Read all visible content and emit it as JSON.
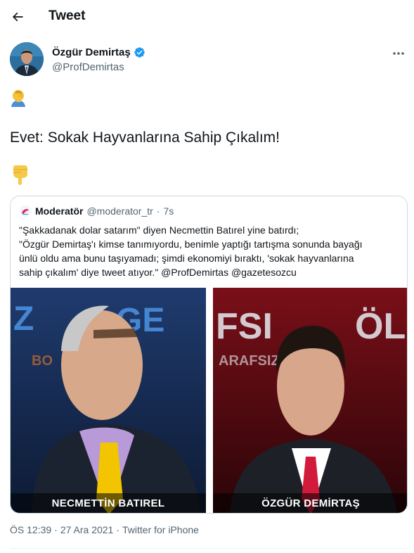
{
  "header": {
    "title": "Tweet",
    "back_icon": "arrow-left-icon"
  },
  "author": {
    "name": "Özgür Demirtaş",
    "handle": "@ProfDemirtas",
    "verified": true
  },
  "tweet": {
    "line1_emoji": "facepalm-emoji",
    "text": "Evet: Sokak Hayvanlarına Sahip Çıkalım!",
    "line3_emoji": "pointing-down-emoji"
  },
  "quote": {
    "name": "Moderatör",
    "handle": "@moderator_tr",
    "dot": "·",
    "time": "7s",
    "text_lines": [
      "\"Şakkadanak dolar satarım\" diyen Necmettin Batırel yine batırdı;",
      "\"Özgür Demirtaş'ı kimse tanımıyordu, benimle yaptığı tartışma sonunda bayağı",
      "ünlü oldu ama bunu taşıyamadı; şimdi ekonomiyi bıraktı, 'sokak hayvanlarına",
      "sahip çıkalım' diye tweet atıyor.\" @ProfDemirtas @gazetesozcu"
    ],
    "image": {
      "left_caption": "NECMETTİN BATIREL",
      "right_caption": "ÖZGÜR DEMİRTAŞ"
    }
  },
  "meta": {
    "time": "ÖS 12:39",
    "sep1": "·",
    "date": "27 Ara 2021",
    "sep2": "·",
    "source": "Twitter for iPhone"
  },
  "colors": {
    "verified_blue": "#1d9bf0",
    "secondary_text": "#536471",
    "border": "#cfd9de"
  }
}
